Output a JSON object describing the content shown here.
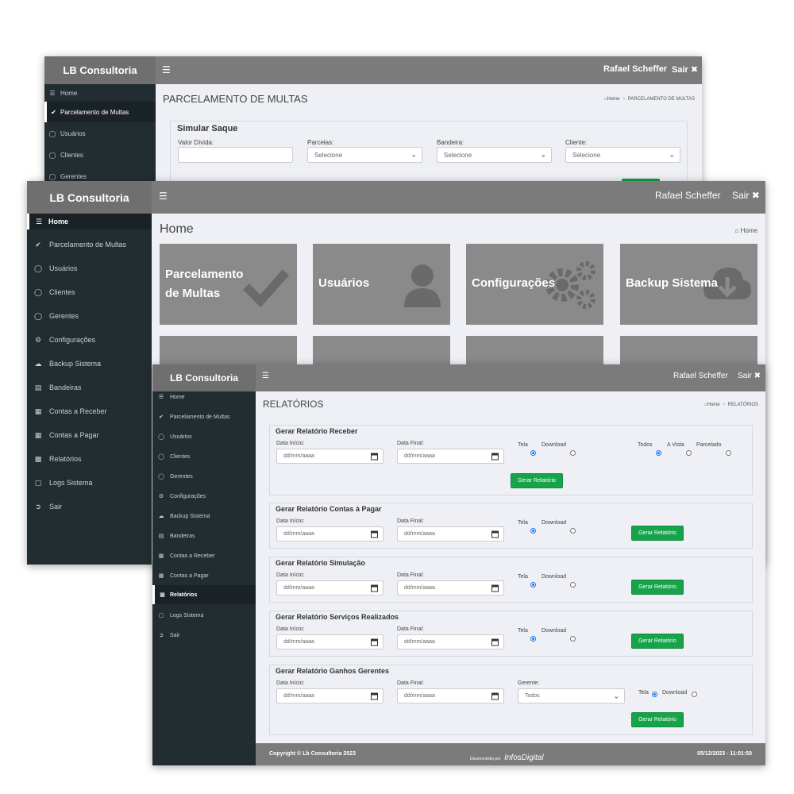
{
  "app": {
    "brand": "LB Consultoria",
    "user": "Rafael Scheffer",
    "logout": "Sair",
    "colors": {
      "topbar": "#7b7b7b",
      "sidebar": "#222d32",
      "button": "#16a34a",
      "tile": "#8a8a8a"
    }
  },
  "win1": {
    "title": "PARCELAMENTO DE MULTAS",
    "breadcrumb": {
      "home": "Home",
      "current": "PARCELAMENTO DE MULTAS"
    },
    "sidebar": [
      "Home",
      "Parcelamento de Multas",
      "Usuários",
      "Clientes",
      "Gerentes"
    ],
    "form": {
      "title": "Simular Saque",
      "valor_label": "Valor Dívida:",
      "valor_value": "",
      "parcelas_label": "Parcelas:",
      "parcelas_value": "Selecione",
      "bandeira_label": "Bandeira:",
      "bandeira_value": "Selecione",
      "cliente_label": "Cliente:",
      "cliente_value": "Selecione"
    }
  },
  "win2": {
    "title": "Home",
    "breadcrumb": {
      "home": "Home"
    },
    "sidebar": [
      "Home",
      "Parcelamento de Multas",
      "Usuários",
      "Clientes",
      "Gerentes",
      "Configurações",
      "Backup Sistema",
      "Bandeiras",
      "Contas a Receber",
      "Contas a Pagar",
      "Relatórios",
      "Logs Sistema",
      "Sair"
    ],
    "tiles": [
      {
        "line1": "Parcelamento",
        "line2": "de Multas",
        "icon": "check-icon"
      },
      {
        "line1": "Usuários",
        "line2": "",
        "icon": "user-icon"
      },
      {
        "line1": "Configurações",
        "line2": "",
        "icon": "gears-icon"
      },
      {
        "line1": "Backup Sistema",
        "line2": "",
        "icon": "cloud-download-icon"
      }
    ]
  },
  "win3": {
    "title": "RELATÓRIOS",
    "breadcrumb": {
      "home": "Home",
      "current": "RELATÓRIOS"
    },
    "sidebar": [
      "Home",
      "Parcelamento de Multas",
      "Usuários",
      "Clientes",
      "Gerentes",
      "Configurações",
      "Backup Sistema",
      "Bandeiras",
      "Contas a Receber",
      "Contas a Pagar",
      "Relatórios",
      "Logs Sistema",
      "Sair"
    ],
    "common": {
      "data_inicio": "Data Início:",
      "data_final": "Data Final:",
      "date_placeholder": "dd/mm/aaaa",
      "tela": "Tela",
      "download": "Download",
      "button": "Gerar Relatório"
    },
    "reports": [
      {
        "title": "Gerar Relatório Receber",
        "todos": "Todos",
        "avista": "A Vista",
        "parcelado": "Parcelado"
      },
      {
        "title": "Gerar Relatório Contas à Pagar"
      },
      {
        "title": "Gerar Relatório Simulação"
      },
      {
        "title": "Gerar Relatório Serviços Realizados"
      },
      {
        "title": "Gerar Relatório Ganhos Gerentes",
        "gerente_label": "Gerente:",
        "gerente_value": "Todos"
      }
    ],
    "footer": {
      "copyright": "Copyright © Lb Consultoria 2023",
      "dev_label": "Desenvolvido por",
      "dev_brand": "InfosDigital",
      "datetime": "05/12/2023 - 11:01:50"
    }
  }
}
